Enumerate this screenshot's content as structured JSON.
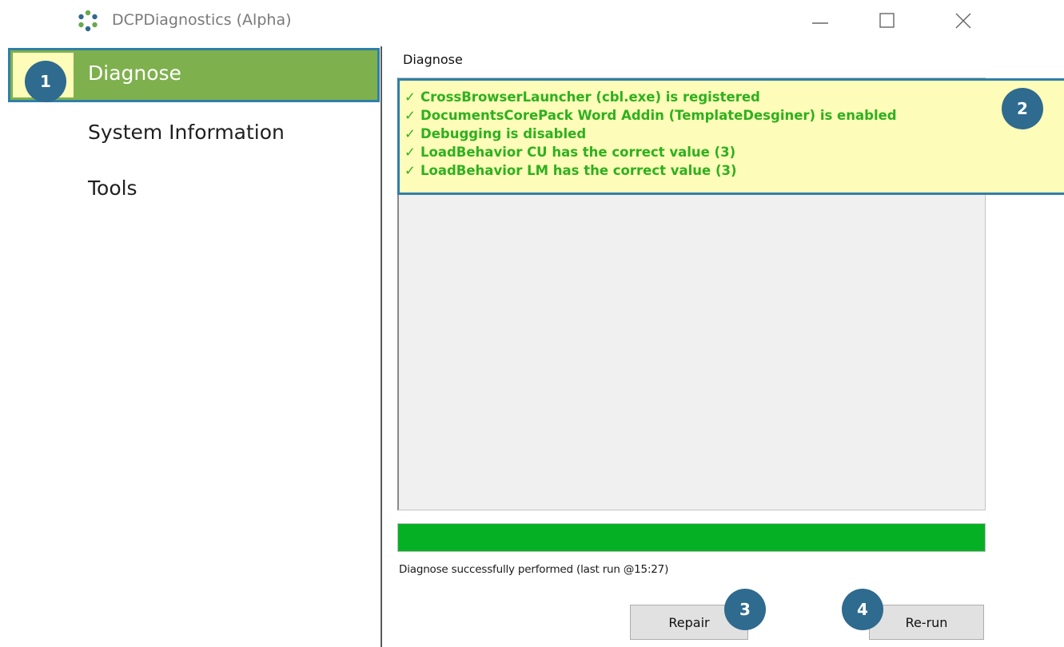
{
  "window": {
    "title": "DCPDiagnostics (Alpha)",
    "app_icon": "dcp-logo-icon",
    "controls": [
      "minimize-icon",
      "maximize-icon",
      "close-icon"
    ]
  },
  "sidebar": {
    "items": [
      {
        "label": "Diagnose",
        "active": true
      },
      {
        "label": "System Information",
        "active": false
      },
      {
        "label": "Tools",
        "active": false
      }
    ]
  },
  "main": {
    "section_title": "Diagnose",
    "results": [
      {
        "check": "✓",
        "text": "CrossBrowserLauncher (cbl.exe) is registered"
      },
      {
        "check": "✓",
        "text": "DocumentsCorePack Word Addin (TemplateDesginer) is enabled"
      },
      {
        "check": "✓",
        "text": "Debugging is disabled"
      },
      {
        "check": "✓",
        "text": "LoadBehavior CU has the correct value (3)"
      },
      {
        "check": "✓",
        "text": "LoadBehavior LM has the correct value (3)"
      }
    ],
    "progress_percent": 100,
    "status": "Diagnose successfully performed (last run @15:27)",
    "repair_label": "Repair",
    "rerun_label": "Re-run"
  },
  "callouts": [
    "1",
    "2",
    "3",
    "4"
  ],
  "colors": {
    "active_nav": "#7fb04e",
    "highlight": "#fdfcb8",
    "callout_border": "#2f7fa8",
    "badge": "#2f6a8f",
    "success_text": "#2fb01f",
    "progress": "#06b025"
  }
}
